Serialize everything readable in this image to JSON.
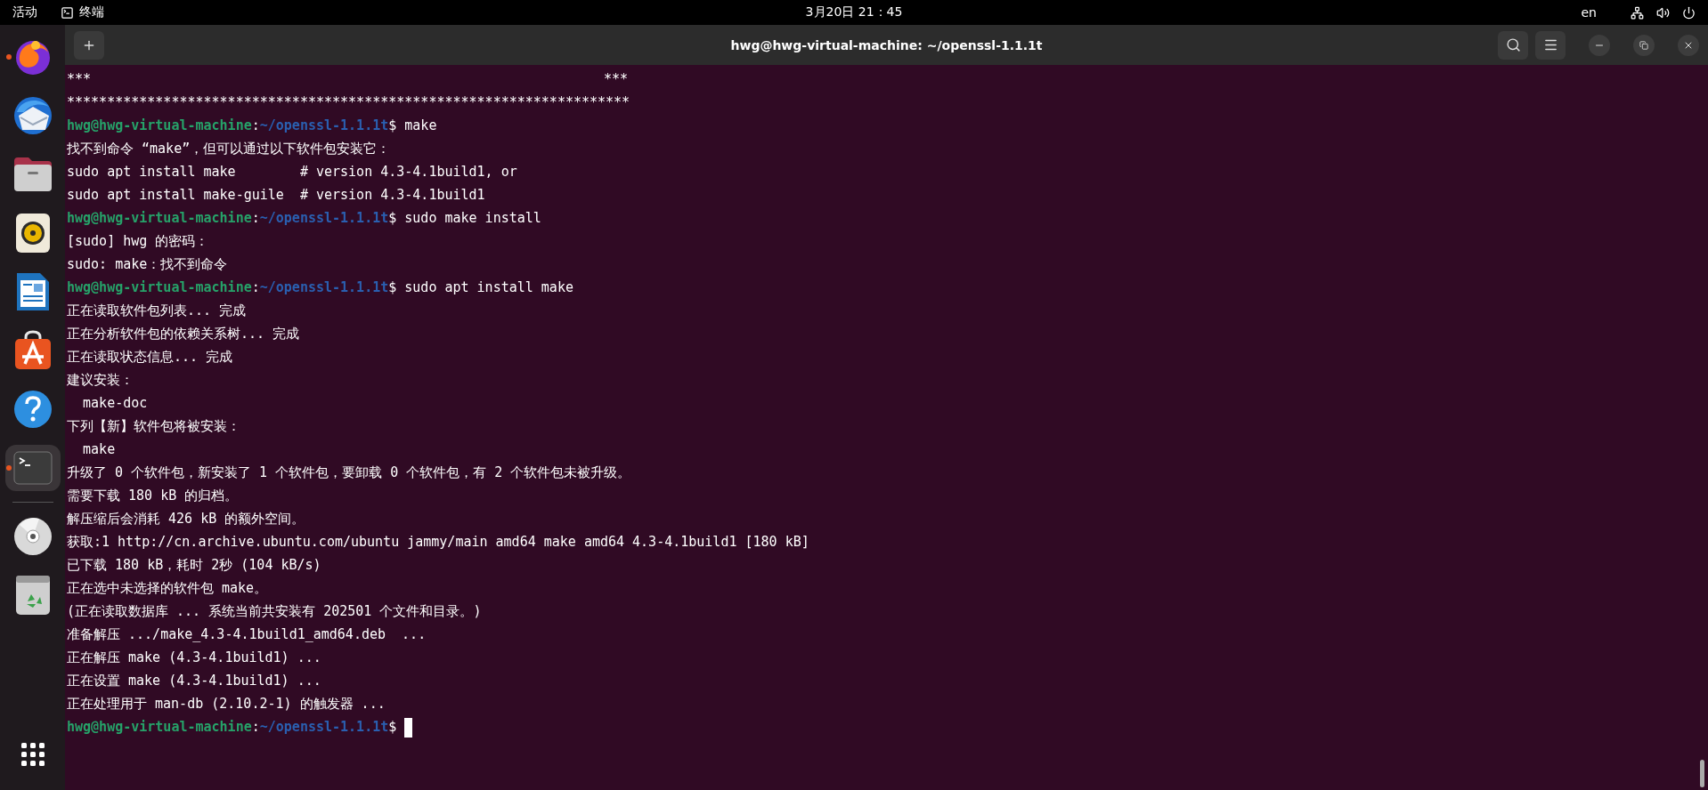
{
  "top_bar": {
    "activities": "活动",
    "app_name": "终端",
    "clock": "3月20日  21：45",
    "language": "en"
  },
  "dock": {
    "items": [
      {
        "kind": "browser",
        "running": true,
        "selected": false
      },
      {
        "kind": "mail",
        "running": false,
        "selected": false
      },
      {
        "kind": "files",
        "running": false,
        "selected": false
      },
      {
        "kind": "music",
        "running": false,
        "selected": false
      },
      {
        "kind": "writer",
        "running": false,
        "selected": false
      },
      {
        "kind": "store",
        "running": false,
        "selected": false
      },
      {
        "kind": "help",
        "running": false,
        "selected": false
      },
      {
        "kind": "terminal",
        "running": true,
        "selected": true
      },
      {
        "kind": "disc",
        "running": false,
        "selected": false
      },
      {
        "kind": "trash",
        "running": false,
        "selected": false
      }
    ]
  },
  "window": {
    "title": "hwg@hwg-virtual-machine: ~/openssl-1.1.1t"
  },
  "terminal": {
    "lines": [
      {
        "kind": "split",
        "left": "***",
        "right": "***"
      },
      {
        "kind": "output",
        "text": "**********************************************************************"
      },
      {
        "kind": "prompt",
        "user_host": "hwg@hwg-virtual-machine",
        "separator": ":",
        "path": "~/openssl-1.1.1t",
        "symbol": "$",
        "command": " make",
        "cursor": false
      },
      {
        "kind": "output",
        "text": "找不到命令 “make”，但可以通过以下软件包安装它："
      },
      {
        "kind": "output",
        "text": "sudo apt install make        # version 4.3-4.1build1, or"
      },
      {
        "kind": "output",
        "text": "sudo apt install make-guile  # version 4.3-4.1build1"
      },
      {
        "kind": "prompt",
        "user_host": "hwg@hwg-virtual-machine",
        "separator": ":",
        "path": "~/openssl-1.1.1t",
        "symbol": "$",
        "command": " sudo make install",
        "cursor": false
      },
      {
        "kind": "output",
        "text": "[sudo] hwg 的密码："
      },
      {
        "kind": "output",
        "text": "sudo: make：找不到命令"
      },
      {
        "kind": "prompt",
        "user_host": "hwg@hwg-virtual-machine",
        "separator": ":",
        "path": "~/openssl-1.1.1t",
        "symbol": "$",
        "command": " sudo apt install make",
        "cursor": false
      },
      {
        "kind": "output",
        "text": "正在读取软件包列表... 完成"
      },
      {
        "kind": "output",
        "text": "正在分析软件包的依赖关系树... 完成"
      },
      {
        "kind": "output",
        "text": "正在读取状态信息... 完成"
      },
      {
        "kind": "output",
        "text": "建议安装："
      },
      {
        "kind": "output",
        "text": "  make-doc"
      },
      {
        "kind": "output",
        "text": "下列【新】软件包将被安装："
      },
      {
        "kind": "output",
        "text": "  make"
      },
      {
        "kind": "output",
        "text": "升级了 0 个软件包，新安装了 1 个软件包，要卸载 0 个软件包，有 2 个软件包未被升级。"
      },
      {
        "kind": "output",
        "text": "需要下载 180 kB 的归档。"
      },
      {
        "kind": "output",
        "text": "解压缩后会消耗 426 kB 的额外空间。"
      },
      {
        "kind": "output",
        "text": "获取:1 http://cn.archive.ubuntu.com/ubuntu jammy/main amd64 make amd64 4.3-4.1build1 [180 kB]"
      },
      {
        "kind": "output",
        "text": "已下载 180 kB，耗时 2秒 (104 kB/s)"
      },
      {
        "kind": "output",
        "text": "正在选中未选择的软件包 make。"
      },
      {
        "kind": "output",
        "text": "(正在读取数据库 ... 系统当前共安装有 202501 个文件和目录。)"
      },
      {
        "kind": "output",
        "text": "准备解压 .../make_4.3-4.1build1_amd64.deb  ..."
      },
      {
        "kind": "output",
        "text": "正在解压 make (4.3-4.1build1) ..."
      },
      {
        "kind": "output",
        "text": "正在设置 make (4.3-4.1build1) ..."
      },
      {
        "kind": "output",
        "text": "正在处理用于 man-db (2.10.2-1) 的触发器 ..."
      },
      {
        "kind": "prompt",
        "user_host": "hwg@hwg-virtual-machine",
        "separator": ":",
        "path": "~/openssl-1.1.1t",
        "symbol": "$",
        "cursor": true
      }
    ]
  }
}
